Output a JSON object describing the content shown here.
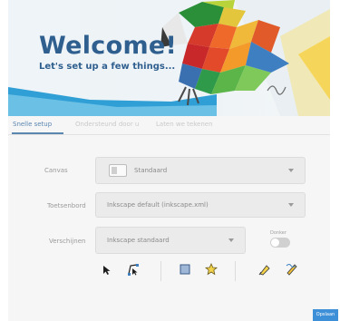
{
  "banner": {
    "title": "Welcome!",
    "subtitle": "Let's set up a few things...",
    "artist_signature": "Sly"
  },
  "tabs": [
    {
      "label": "Snelle setup",
      "active": true
    },
    {
      "label": "Ondersteund door u",
      "active": false
    },
    {
      "label": "Laten we tekenen",
      "active": false
    }
  ],
  "form": {
    "canvas": {
      "label": "Canvas",
      "value": "Standaard"
    },
    "keyboard": {
      "label": "Toetsenbord",
      "value": "Inkscape default (inkscape.xml)"
    },
    "appearance": {
      "label": "Verschijnen",
      "value": "Inkscape standaard"
    },
    "dark": {
      "label": "Donker",
      "on": false
    }
  },
  "theme_icons": [
    "select-arrow-icon",
    "node-tool-icon",
    "rectangle-icon",
    "star-tool-icon",
    "pen-icon",
    "pencil-icon"
  ],
  "footer": {
    "save_label": "Opslaan"
  },
  "colors": {
    "accent": "#5a86b0",
    "title": "#2f5f8f",
    "save": "#3d8fd8"
  }
}
